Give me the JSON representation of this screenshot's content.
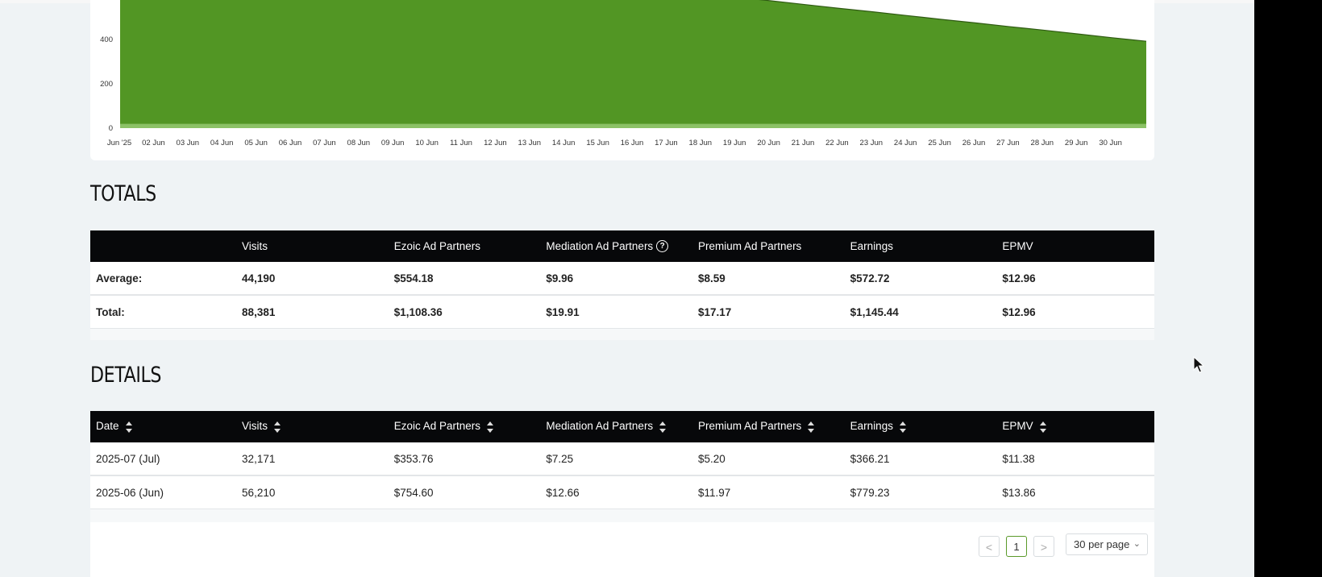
{
  "chart_data": {
    "type": "area",
    "x_tick_labels": [
      "Jun '25",
      "02 Jun",
      "03 Jun",
      "04 Jun",
      "05 Jun",
      "06 Jun",
      "07 Jun",
      "08 Jun",
      "09 Jun",
      "10 Jun",
      "11 Jun",
      "12 Jun",
      "13 Jun",
      "14 Jun",
      "15 Jun",
      "16 Jun",
      "17 Jun",
      "18 Jun",
      "19 Jun",
      "20 Jun",
      "21 Jun",
      "22 Jun",
      "23 Jun",
      "24 Jun",
      "25 Jun",
      "26 Jun",
      "27 Jun",
      "28 Jun",
      "29 Jun",
      "30 Jun"
    ],
    "y_tick_labels": [
      "0",
      "200",
      "400"
    ],
    "ylim": [
      0,
      600
    ],
    "series": [
      {
        "color": "#8cc266",
        "values": [
          20,
          20,
          20,
          20,
          20,
          20,
          20,
          20,
          20,
          20,
          20,
          20,
          20,
          20,
          20,
          20,
          20,
          20,
          20,
          20,
          20,
          20,
          20,
          20,
          20,
          20,
          20,
          20,
          20,
          20,
          20
        ]
      },
      {
        "color": "#529624",
        "values": [
          600,
          600,
          600,
          600,
          600,
          600,
          600,
          600,
          600,
          600,
          600,
          600,
          600,
          600,
          600,
          600,
          600,
          588,
          571,
          555,
          538,
          521,
          505,
          488,
          471,
          455,
          438,
          422,
          405,
          388,
          372
        ]
      }
    ]
  },
  "totals": {
    "title": "TOTALS",
    "headers": [
      "",
      "Visits",
      "Ezoic Ad Partners",
      "Mediation Ad Partners",
      "Premium Ad Partners",
      "Earnings",
      "EPMV"
    ],
    "rows": [
      [
        "Average:",
        "44,190",
        "$554.18",
        "$9.96",
        "$8.59",
        "$572.72",
        "$12.96"
      ],
      [
        "Total:",
        "88,381",
        "$1,108.36",
        "$19.91",
        "$17.17",
        "$1,145.44",
        "$12.96"
      ]
    ]
  },
  "details": {
    "title": "DETAILS",
    "headers": [
      "Date",
      "Visits",
      "Ezoic Ad Partners",
      "Mediation Ad Partners",
      "Premium Ad Partners",
      "Earnings",
      "EPMV"
    ],
    "rows": [
      [
        "2025-07 (Jul)",
        "32,171",
        "$353.76",
        "$7.25",
        "$5.20",
        "$366.21",
        "$11.38"
      ],
      [
        "2025-06 (Jun)",
        "56,210",
        "$754.60",
        "$12.66",
        "$11.97",
        "$779.23",
        "$13.86"
      ]
    ]
  },
  "pagination": {
    "prev": "<",
    "current": "1",
    "next": ">",
    "per_page": "30 per page"
  },
  "colors": {
    "header_bg": "#07080a",
    "chart_main": "#529624",
    "chart_base": "#8cc266",
    "accent": "#5b9a2a"
  }
}
